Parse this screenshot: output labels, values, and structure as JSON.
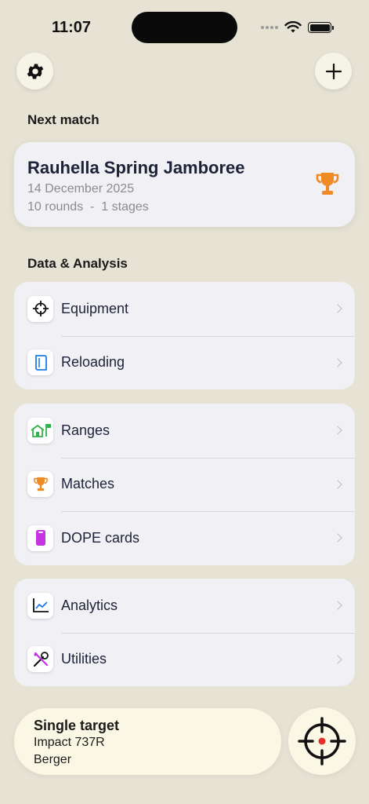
{
  "status": {
    "time": "11:07"
  },
  "next_match": {
    "section_title": "Next match",
    "name": "Rauhella Spring Jamboree",
    "date": "14 December 2025",
    "meta": "10 rounds  -  1 stages",
    "icon": "trophy-icon"
  },
  "data_analysis": {
    "section_title": "Data & Analysis",
    "group1": [
      {
        "label": "Equipment",
        "icon": "crosshair-icon"
      },
      {
        "label": "Reloading",
        "icon": "reloading-book-icon"
      }
    ],
    "group2": [
      {
        "label": "Ranges",
        "icon": "range-house-icon"
      },
      {
        "label": "Matches",
        "icon": "trophy-icon"
      },
      {
        "label": "DOPE cards",
        "icon": "dope-card-icon"
      }
    ],
    "group3": [
      {
        "label": "Analytics",
        "icon": "chart-icon"
      },
      {
        "label": "Utilities",
        "icon": "tools-icon"
      }
    ]
  },
  "bottom": {
    "target_title": "Single target",
    "rifle": "Impact 737R",
    "bullet": "Berger",
    "shoot_icon": "target-crosshair-icon"
  },
  "colors": {
    "background": "#e6e3d5",
    "accent": "#f08a24",
    "card": "#f1f0f4"
  }
}
